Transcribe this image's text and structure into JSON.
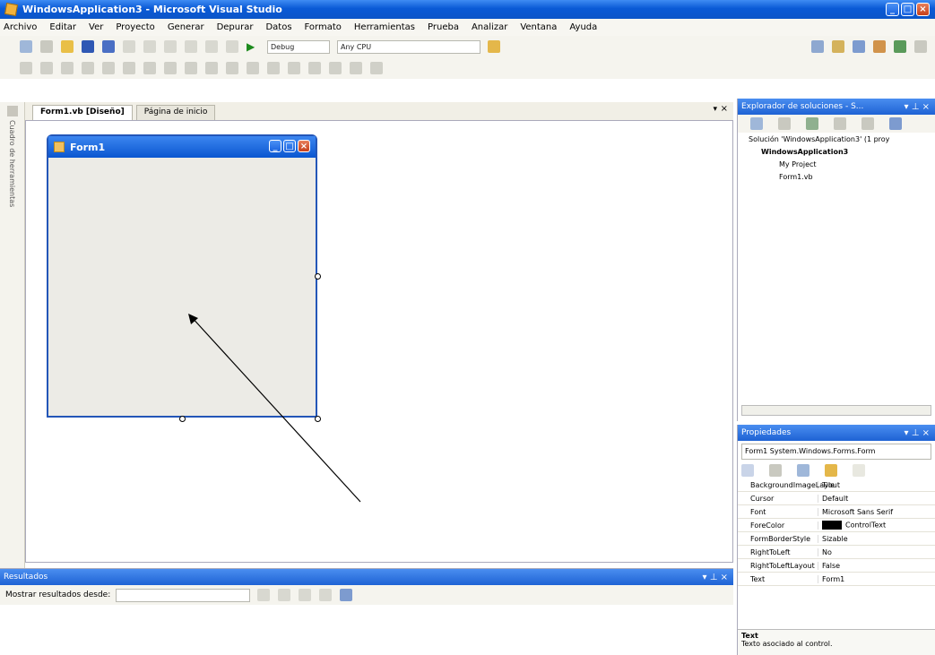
{
  "window": {
    "title": "WindowsApplication3 - Microsoft Visual Studio"
  },
  "menu": [
    "Archivo",
    "Editar",
    "Ver",
    "Proyecto",
    "Generar",
    "Depurar",
    "Datos",
    "Formato",
    "Herramientas",
    "Prueba",
    "Analizar",
    "Ventana",
    "Ayuda"
  ],
  "toolbar": {
    "config": "Debug",
    "platform": "Any CPU"
  },
  "tabs": {
    "design": "Form1.vb [Diseño]",
    "start": "Página de inicio"
  },
  "left_strip": {
    "label": "Cuadro de herramientas"
  },
  "form": {
    "title": "Form1"
  },
  "solution_explorer": {
    "title": "Explorador de soluciones - S...",
    "items": [
      "Solución 'WindowsApplication3' (1 proy",
      "WindowsApplication3",
      "My Project",
      "Form1.vb"
    ]
  },
  "properties": {
    "title": "Propiedades",
    "object": "Form1 System.Windows.Forms.Form",
    "rows": [
      {
        "name": "BackgroundImageLayout",
        "value": "Tile"
      },
      {
        "name": "Cursor",
        "value": "Default"
      },
      {
        "name": "Font",
        "value": "Microsoft Sans Serif"
      },
      {
        "name": "ForeColor",
        "value": "ControlText"
      },
      {
        "name": "FormBorderStyle",
        "value": "Sizable"
      },
      {
        "name": "RightToLeft",
        "value": "No"
      },
      {
        "name": "RightToLeftLayout",
        "value": "False"
      },
      {
        "name": "Text",
        "value": "Form1"
      }
    ],
    "desc_title": "Text",
    "desc_body": "Texto asociado al control."
  },
  "output": {
    "title": "Resultados",
    "label": "Mostrar resultados desde:"
  }
}
